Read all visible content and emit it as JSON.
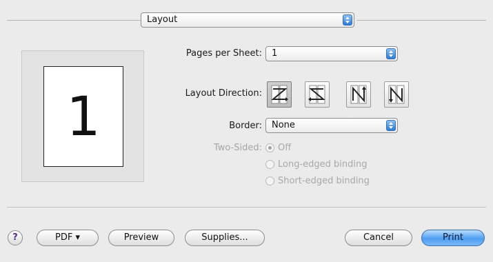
{
  "panel_menu": {
    "selected": "Layout"
  },
  "preview": {
    "page_number": "1"
  },
  "pages_per_sheet": {
    "label": "Pages per Sheet:",
    "value": "1"
  },
  "layout_direction": {
    "label": "Layout Direction:",
    "options": [
      "left-to-right-then-down",
      "right-to-left-then-down",
      "top-to-bottom-then-right",
      "top-to-bottom-then-left"
    ],
    "selected_index": 0
  },
  "border": {
    "label": "Border:",
    "value": "None"
  },
  "two_sided": {
    "label": "Two-Sided:",
    "options": [
      "Off",
      "Long-edged binding",
      "Short-edged binding"
    ],
    "selected_index": 0,
    "enabled": false
  },
  "buttons": {
    "help": "?",
    "pdf": "PDF ▾",
    "preview": "Preview",
    "supplies": "Supplies...",
    "cancel": "Cancel",
    "print": "Print"
  },
  "colors": {
    "accent": "#4f9ef2",
    "disabled_text": "#a5a5a5"
  }
}
